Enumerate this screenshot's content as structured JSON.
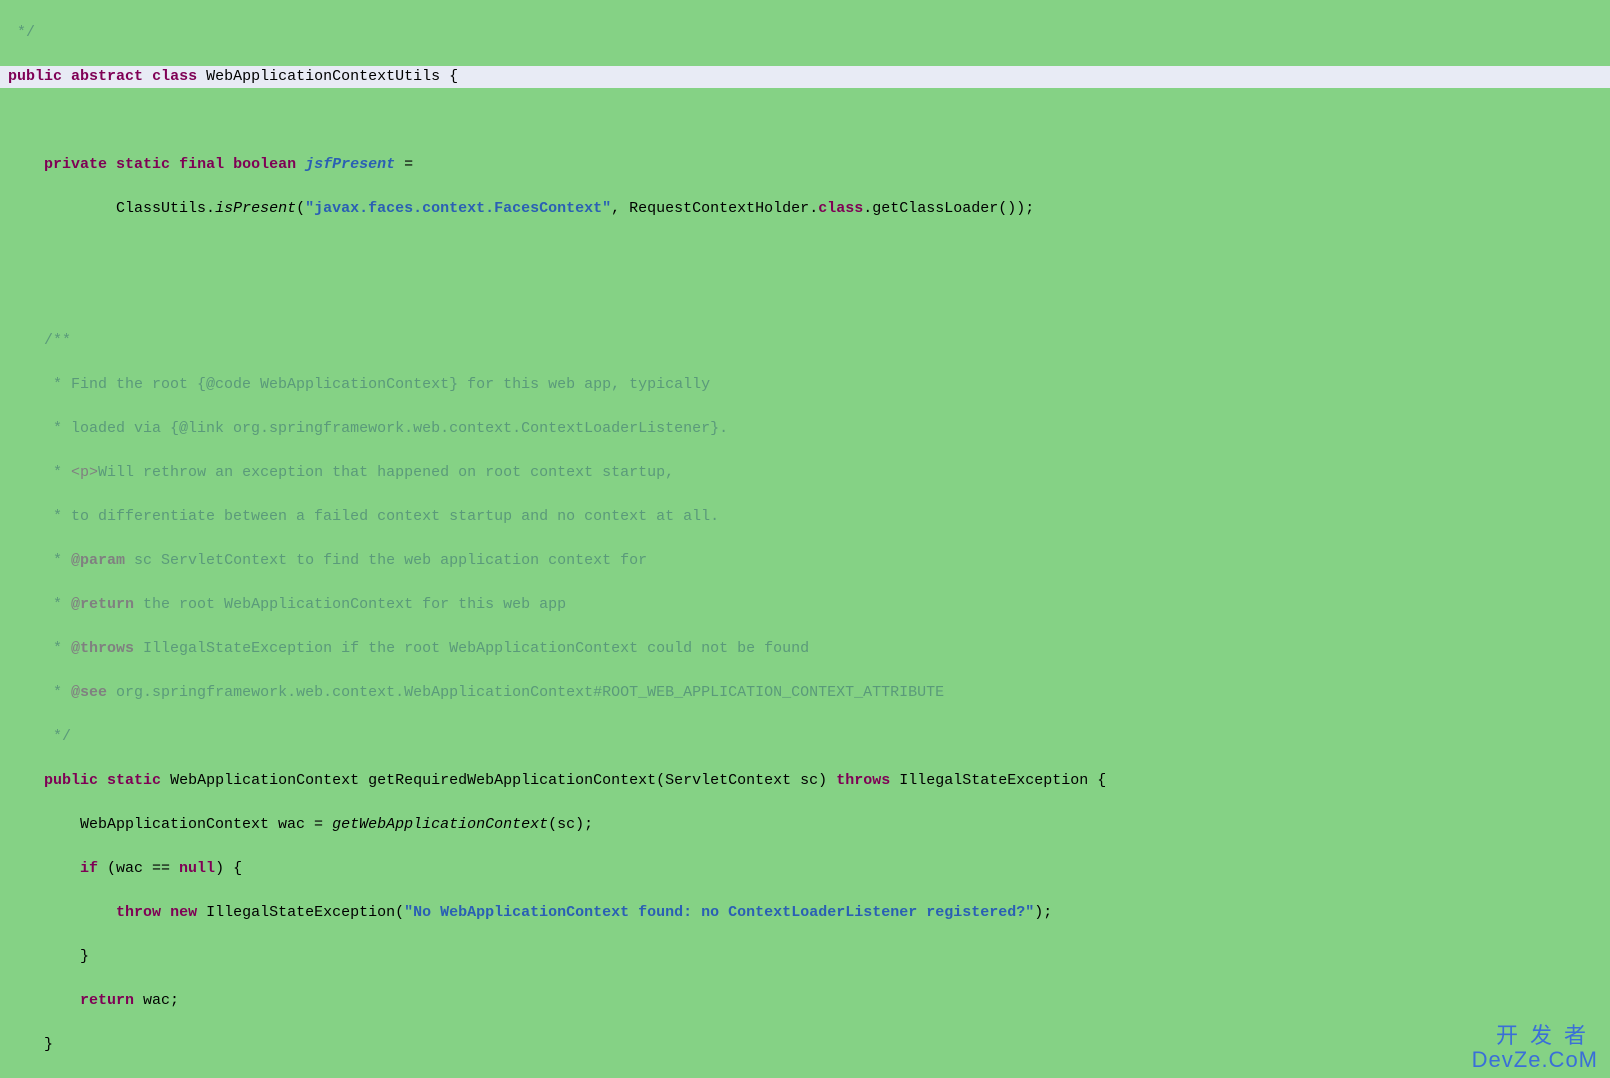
{
  "code": {
    "l1": " */",
    "kw_public": "public",
    "kw_abstract": "abstract",
    "kw_class": "class",
    "class_name": "WebApplicationContextUtils",
    "brace_open": " {",
    "kw_private": "private",
    "kw_static": "static",
    "kw_final": "final",
    "kw_boolean": "boolean",
    "field_name": "jsfPresent",
    "eq": " =",
    "line5_a": "ClassUtils.",
    "line5_m": "isPresent",
    "line5_b": "(",
    "line5_str": "\"javax.faces.context.FacesContext\"",
    "line5_c": ", RequestContextHolder.",
    "line5_class_kw": "class",
    "line5_d": ".getClassLoader());",
    "javadoc_open": "/**",
    "jd1": " * Find the root {@code WebApplicationContext} for this web app, typically",
    "jd2": " * loaded via {@link org.springframework.web.context.ContextLoaderListener}.",
    "jd3a": " * ",
    "jd3_tag": "<p>",
    "jd3b": "Will rethrow an exception that happened on root context startup,",
    "jd4": " * to differentiate between a failed context startup and no context at all.",
    "jd5a": " * ",
    "jd5_kw": "@param",
    "jd5b": " sc ServletContext to find the web application context for",
    "jd6a": " * ",
    "jd6_kw": "@return",
    "jd6b": " the root WebApplicationContext for this web app",
    "jd7a": " * ",
    "jd7_kw": "@throws",
    "jd7b": " IllegalStateException if the root WebApplicationContext could not be found",
    "jd8a": " * ",
    "jd8_kw": "@see",
    "jd8b": " org.springframework.web.context.WebApplicationContext#ROOT_WEB_APPLICATION_CONTEXT_ATTRIBUTE",
    "javadoc_close": " */",
    "m_kw_public": "public",
    "m_kw_static": "static",
    "m_ret": " WebApplicationContext getRequiredWebApplicationContext(ServletContext sc) ",
    "m_kw_throws": "throws",
    "m_throws_type": " IllegalStateException {",
    "m_body1a": "WebApplicationContext wac = ",
    "m_body1m": "getWebApplicationContext",
    "m_body1b": "(sc);",
    "kw_if": "if",
    "if_cond_a": " (wac == ",
    "kw_null": "null",
    "if_cond_b": ") {",
    "kw_throw": "throw",
    "kw_new": "new",
    "throw_a": " IllegalStateException(",
    "throw_str": "\"No WebApplicationContext found: no ContextLoaderListener registered?\"",
    "throw_b": ");",
    "brace_close1": "}",
    "kw_return": "return",
    "return_a": " wac;",
    "brace_close2": "}"
  },
  "watermark": {
    "cn": "开发者",
    "en": "DevZe.CoM"
  }
}
